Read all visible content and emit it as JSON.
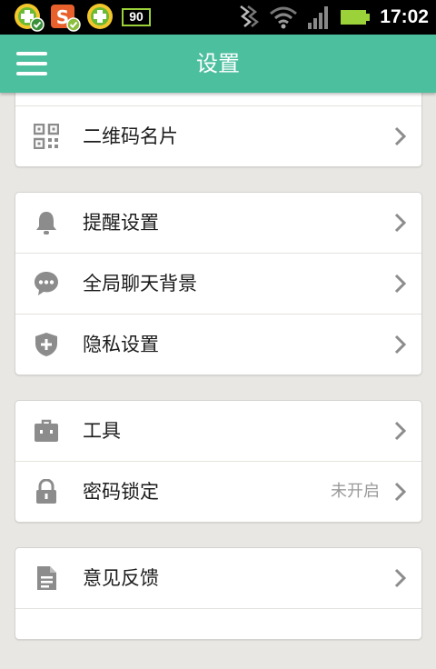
{
  "status_bar": {
    "time": "17:02",
    "app_badge": "90",
    "icons": [
      "app-shield-check-icon",
      "sogou-input-icon",
      "plus-check-icon",
      "battery-90-icon",
      "data-activity-icon",
      "wifi-icon",
      "signal-icon",
      "battery-icon"
    ]
  },
  "header": {
    "title": "设置",
    "bg_color": "#4cbf9f"
  },
  "groups": [
    {
      "items": [
        {
          "icon": "qr-code-icon",
          "label": "二维码名片"
        }
      ]
    },
    {
      "items": [
        {
          "icon": "bell-icon",
          "label": "提醒设置"
        },
        {
          "icon": "chat-bubble-icon",
          "label": "全局聊天背景"
        },
        {
          "icon": "shield-icon",
          "label": "隐私设置"
        }
      ]
    },
    {
      "items": [
        {
          "icon": "toolbox-icon",
          "label": "工具"
        },
        {
          "icon": "lock-icon",
          "label": "密码锁定",
          "status": "未开启"
        }
      ]
    },
    {
      "items": [
        {
          "icon": "document-icon",
          "label": "意见反馈"
        }
      ]
    }
  ]
}
